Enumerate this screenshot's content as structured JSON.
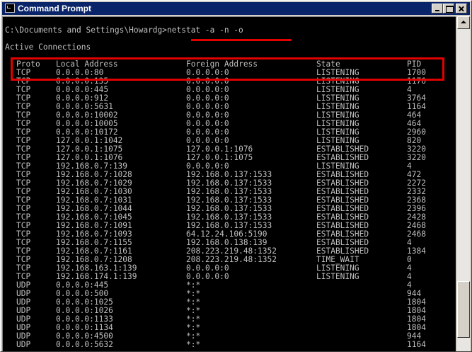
{
  "window": {
    "title": "Command Prompt"
  },
  "console": {
    "prompt": "C:\\Documents and Settings\\Howardg>",
    "command": "netstat -a -n -o",
    "heading": "Active Connections",
    "columns": [
      "Proto",
      "Local Address",
      "Foreign Address",
      "State",
      "PID"
    ],
    "rows": [
      [
        "TCP",
        "0.0.0.0:80",
        "0.0.0.0:0",
        "LISTENING",
        "1700"
      ],
      [
        "TCP",
        "0.0.0.0:135",
        "0.0.0.0:0",
        "LISTENING",
        "1176"
      ],
      [
        "TCP",
        "0.0.0.0:445",
        "0.0.0.0:0",
        "LISTENING",
        "4"
      ],
      [
        "TCP",
        "0.0.0.0:912",
        "0.0.0.0:0",
        "LISTENING",
        "3764"
      ],
      [
        "TCP",
        "0.0.0.0:5631",
        "0.0.0.0:0",
        "LISTENING",
        "1164"
      ],
      [
        "TCP",
        "0.0.0.0:10002",
        "0.0.0.0:0",
        "LISTENING",
        "464"
      ],
      [
        "TCP",
        "0.0.0.0:10005",
        "0.0.0.0:0",
        "LISTENING",
        "464"
      ],
      [
        "TCP",
        "0.0.0.0:10172",
        "0.0.0.0:0",
        "LISTENING",
        "2960"
      ],
      [
        "TCP",
        "127.0.0.1:1042",
        "0.0.0.0:0",
        "LISTENING",
        "820"
      ],
      [
        "TCP",
        "127.0.0.1:1075",
        "127.0.0.1:1076",
        "ESTABLISHED",
        "3220"
      ],
      [
        "TCP",
        "127.0.0.1:1076",
        "127.0.0.1:1075",
        "ESTABLISHED",
        "3220"
      ],
      [
        "TCP",
        "192.168.0.7:139",
        "0.0.0.0:0",
        "LISTENING",
        "4"
      ],
      [
        "TCP",
        "192.168.0.7:1028",
        "192.168.0.137:1533",
        "ESTABLISHED",
        "472"
      ],
      [
        "TCP",
        "192.168.0.7:1029",
        "192.168.0.137:1533",
        "ESTABLISHED",
        "2272"
      ],
      [
        "TCP",
        "192.168.0.7:1030",
        "192.168.0.137:1533",
        "ESTABLISHED",
        "2332"
      ],
      [
        "TCP",
        "192.168.0.7:1031",
        "192.168.0.137:1533",
        "ESTABLISHED",
        "2368"
      ],
      [
        "TCP",
        "192.168.0.7:1044",
        "192.168.0.137:1533",
        "ESTABLISHED",
        "2396"
      ],
      [
        "TCP",
        "192.168.0.7:1045",
        "192.168.0.137:1533",
        "ESTABLISHED",
        "2428"
      ],
      [
        "TCP",
        "192.168.0.7:1091",
        "192.168.0.137:1533",
        "ESTABLISHED",
        "2468"
      ],
      [
        "TCP",
        "192.168.0.7:1093",
        "64.12.24.106:5190",
        "ESTABLISHED",
        "2468"
      ],
      [
        "TCP",
        "192.168.0.7:1155",
        "192.168.0.138:139",
        "ESTABLISHED",
        "4"
      ],
      [
        "TCP",
        "192.168.0.7:1161",
        "208.223.219.48:1352",
        "ESTABLISHED",
        "1384"
      ],
      [
        "TCP",
        "192.168.0.7:1208",
        "208.223.219.48:1352",
        "TIME_WAIT",
        "0"
      ],
      [
        "TCP",
        "192.168.163.1:139",
        "0.0.0.0:0",
        "LISTENING",
        "4"
      ],
      [
        "TCP",
        "192.168.174.1:139",
        "0.0.0.0:0",
        "LISTENING",
        "4"
      ],
      [
        "UDP",
        "0.0.0.0:445",
        "*:*",
        "",
        "4"
      ],
      [
        "UDP",
        "0.0.0.0:500",
        "*:*",
        "",
        "944"
      ],
      [
        "UDP",
        "0.0.0.0:1025",
        "*:*",
        "",
        "1804"
      ],
      [
        "UDP",
        "0.0.0.0:1026",
        "*:*",
        "",
        "1804"
      ],
      [
        "UDP",
        "0.0.0.0:1133",
        "*:*",
        "",
        "1804"
      ],
      [
        "UDP",
        "0.0.0.0:1134",
        "*:*",
        "",
        "1804"
      ],
      [
        "UDP",
        "0.0.0.0:4500",
        "*:*",
        "",
        "944"
      ],
      [
        "UDP",
        "0.0.0.0:5632",
        "*:*",
        "",
        "1164"
      ]
    ]
  },
  "colors": {
    "titlebar": "#0a246a",
    "console_bg": "#000000",
    "console_text": "#c0c0c0",
    "annotation": "#e00000"
  }
}
